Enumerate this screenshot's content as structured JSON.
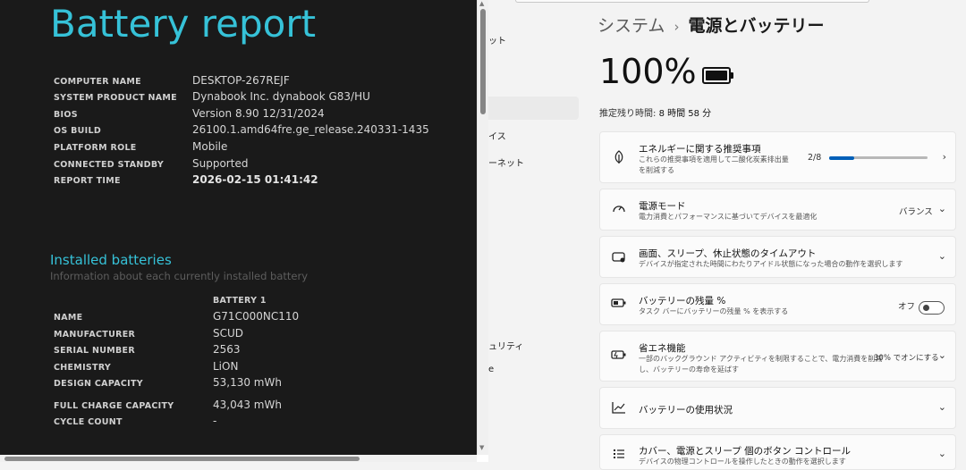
{
  "report": {
    "title": "Battery report",
    "info": [
      {
        "label": "COMPUTER NAME",
        "value": "DESKTOP-267REJF"
      },
      {
        "label": "SYSTEM PRODUCT NAME",
        "value": "Dynabook Inc. dynabook G83/HU"
      },
      {
        "label": "BIOS",
        "value": "Version 8.90 12/31/2024"
      },
      {
        "label": "OS BUILD",
        "value": "26100.1.amd64fre.ge_release.240331-1435"
      },
      {
        "label": "PLATFORM ROLE",
        "value": "Mobile"
      },
      {
        "label": "CONNECTED STANDBY",
        "value": "Supported"
      },
      {
        "label": "REPORT TIME",
        "value": "2026-02-15  01:41:42"
      }
    ],
    "installed": {
      "title": "Installed batteries",
      "subtitle": "Information about each currently installed battery",
      "column": "BATTERY 1",
      "rows": [
        {
          "label": "NAME",
          "value": "G71C000NC110"
        },
        {
          "label": "MANUFACTURER",
          "value": "SCUD"
        },
        {
          "label": "SERIAL NUMBER",
          "value": "2563"
        },
        {
          "label": "CHEMISTRY",
          "value": "LiON"
        },
        {
          "label": "DESIGN CAPACITY",
          "value": "53,130 mWh"
        },
        {
          "label": "FULL CHARGE CAPACITY",
          "value": "43,043 mWh"
        },
        {
          "label": "CYCLE COUNT",
          "value": "-"
        }
      ]
    }
  },
  "nav": {
    "fragments": [
      "ット",
      "イス",
      "ーネット",
      "ュリティ",
      "e"
    ]
  },
  "settings": {
    "breadcrumb": {
      "parent": "システム",
      "separator": "›",
      "current": "電源とバッテリー"
    },
    "battery_percent": "100%",
    "battery_level": 1.0,
    "remaining_label": "推定残り時間:",
    "remaining_value": "8 時間 58 分",
    "cards": [
      {
        "icon": "leaf-icon",
        "title": "エネルギーに関する推奨事項",
        "desc": [
          "これらの推奨事項を適用して二酸化炭素排出量",
          "を削減する"
        ],
        "value": "2/8",
        "progress": 0.25
      },
      {
        "icon": "power-mode-icon",
        "title": "電源モード",
        "desc": [
          "電力消費とパフォーマンスに基づいてデバイスを最適化"
        ],
        "value": "バランス"
      },
      {
        "icon": "screen-sleep-icon",
        "title": "画面、スリープ、休止状態のタイムアウト",
        "desc": [
          "デバイスが指定された時間にわたりアイドル状態になった場合の動作を選択します"
        ]
      },
      {
        "icon": "battery-percent-icon",
        "title": "バッテリーの残量 %",
        "desc": [
          "タスク バーにバッテリーの残量 % を表示する"
        ],
        "value": "オフ"
      },
      {
        "icon": "energy-saver-icon",
        "title": "省エネ機能",
        "desc": [
          "一部のバックグラウンド アクティビティを制限することで、電力消費を削減",
          "し、バッテリーの寿命を延ばす"
        ],
        "value": "30% でオンにする"
      },
      {
        "icon": "chart-icon",
        "title": "バッテリーの使用状況"
      },
      {
        "icon": "buttons-control-icon",
        "title": "カバー、電源とスリープ 個のボタン コントロール",
        "desc": [
          "デバイスの物理コントロールを操作したときの動作を選択します"
        ]
      }
    ]
  }
}
